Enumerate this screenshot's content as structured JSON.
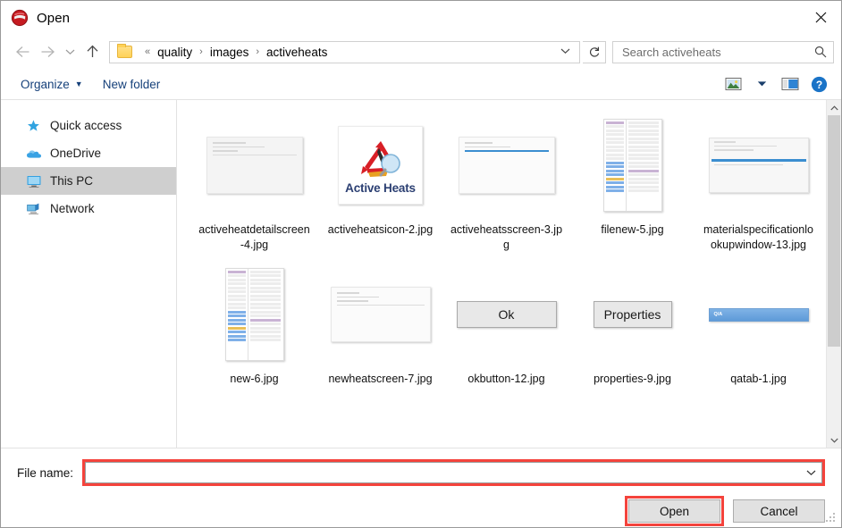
{
  "window": {
    "title": "Open",
    "app_icon": "app-logo-icon",
    "close_label": "✕"
  },
  "nav": {
    "back_icon": "arrow-left-icon",
    "forward_icon": "arrow-right-icon",
    "recent_icon": "chevron-down-icon",
    "up_icon": "arrow-up-icon",
    "breadcrumb": {
      "folder_icon": "folder-icon",
      "overflow": "«",
      "items": [
        "quality",
        "images",
        "activeheats"
      ],
      "separator": "›",
      "dropdown_icon": "chevron-down-icon"
    },
    "refresh_icon": "refresh-icon"
  },
  "search": {
    "placeholder": "Search activeheats",
    "value": "",
    "icon": "search-icon"
  },
  "toolbar": {
    "organize_label": "Organize",
    "organize_caret": "▼",
    "new_folder_label": "New folder",
    "view_icon": "view-layout-icon",
    "view_caret": "▼",
    "pane_icon": "preview-pane-icon",
    "help_icon": "help-icon",
    "help_glyph": "?"
  },
  "sidebar": {
    "items": [
      {
        "label": "Quick access",
        "icon": "star-icon",
        "selected": false
      },
      {
        "label": "OneDrive",
        "icon": "cloud-icon",
        "selected": false
      },
      {
        "label": "This PC",
        "icon": "monitor-icon",
        "selected": true
      },
      {
        "label": "Network",
        "icon": "network-icon",
        "selected": false
      }
    ]
  },
  "files": [
    {
      "name": "activeheatdetailscreen-4.jpg",
      "thumb": "screenshot-light"
    },
    {
      "name": "activeheatsicon-2.jpg",
      "thumb": "active-heats-logo",
      "logo_text": "Active Heats"
    },
    {
      "name": "activeheatsscreen-3.jpg",
      "thumb": "screenshot-blue-divider"
    },
    {
      "name": "filenew-5.jpg",
      "thumb": "list-view"
    },
    {
      "name": "materialspecificationlookupwindow-13.jpg",
      "thumb": "form-window"
    },
    {
      "name": "new-6.jpg",
      "thumb": "list-view"
    },
    {
      "name": "newheatscreen-7.jpg",
      "thumb": "screenshot-wide"
    },
    {
      "name": "okbutton-12.jpg",
      "thumb": "button",
      "button_text": "Ok"
    },
    {
      "name": "properties-9.jpg",
      "thumb": "button-narrow",
      "button_text": "Properties"
    },
    {
      "name": "qatab-1.jpg",
      "thumb": "tab-bar",
      "tab_text": "Q/A"
    }
  ],
  "scrollbar": {
    "up_icon": "chevron-up-icon",
    "down_icon": "chevron-down-icon"
  },
  "footer": {
    "file_name_label": "File name:",
    "file_name_value": "",
    "file_name_placeholder": "",
    "dropdown_icon": "chevron-down-icon",
    "open_label": "Open",
    "cancel_label": "Cancel",
    "resize_grip": "resize-grip-icon"
  },
  "colors": {
    "highlight_red": "#f4433c",
    "selection_gray": "#cfcfcf",
    "accent_blue": "#15407a",
    "help_blue": "#1a73c7"
  }
}
